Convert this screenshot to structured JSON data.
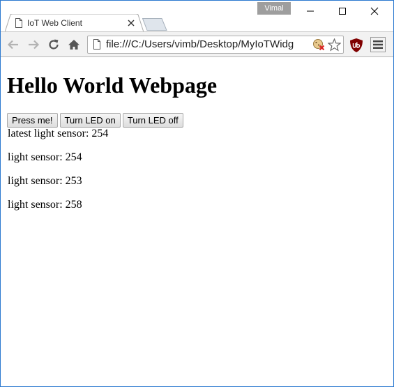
{
  "window": {
    "user_badge": "Vimal"
  },
  "tab": {
    "title": "IoT Web Client"
  },
  "toolbar": {
    "url": "file:///C:/Users/vimb/Desktop/MyIoTWidg"
  },
  "page": {
    "heading": "Hello World Webpage",
    "buttons": [
      {
        "label": "Press me!"
      },
      {
        "label": "Turn LED on"
      },
      {
        "label": "Turn LED off"
      }
    ],
    "lines": [
      "latest light sensor: 254",
      "light sensor: 254",
      "light sensor: 253",
      "light sensor: 258"
    ]
  },
  "colors": {
    "window_border": "#2b79d0",
    "ublock_red": "#800000"
  }
}
